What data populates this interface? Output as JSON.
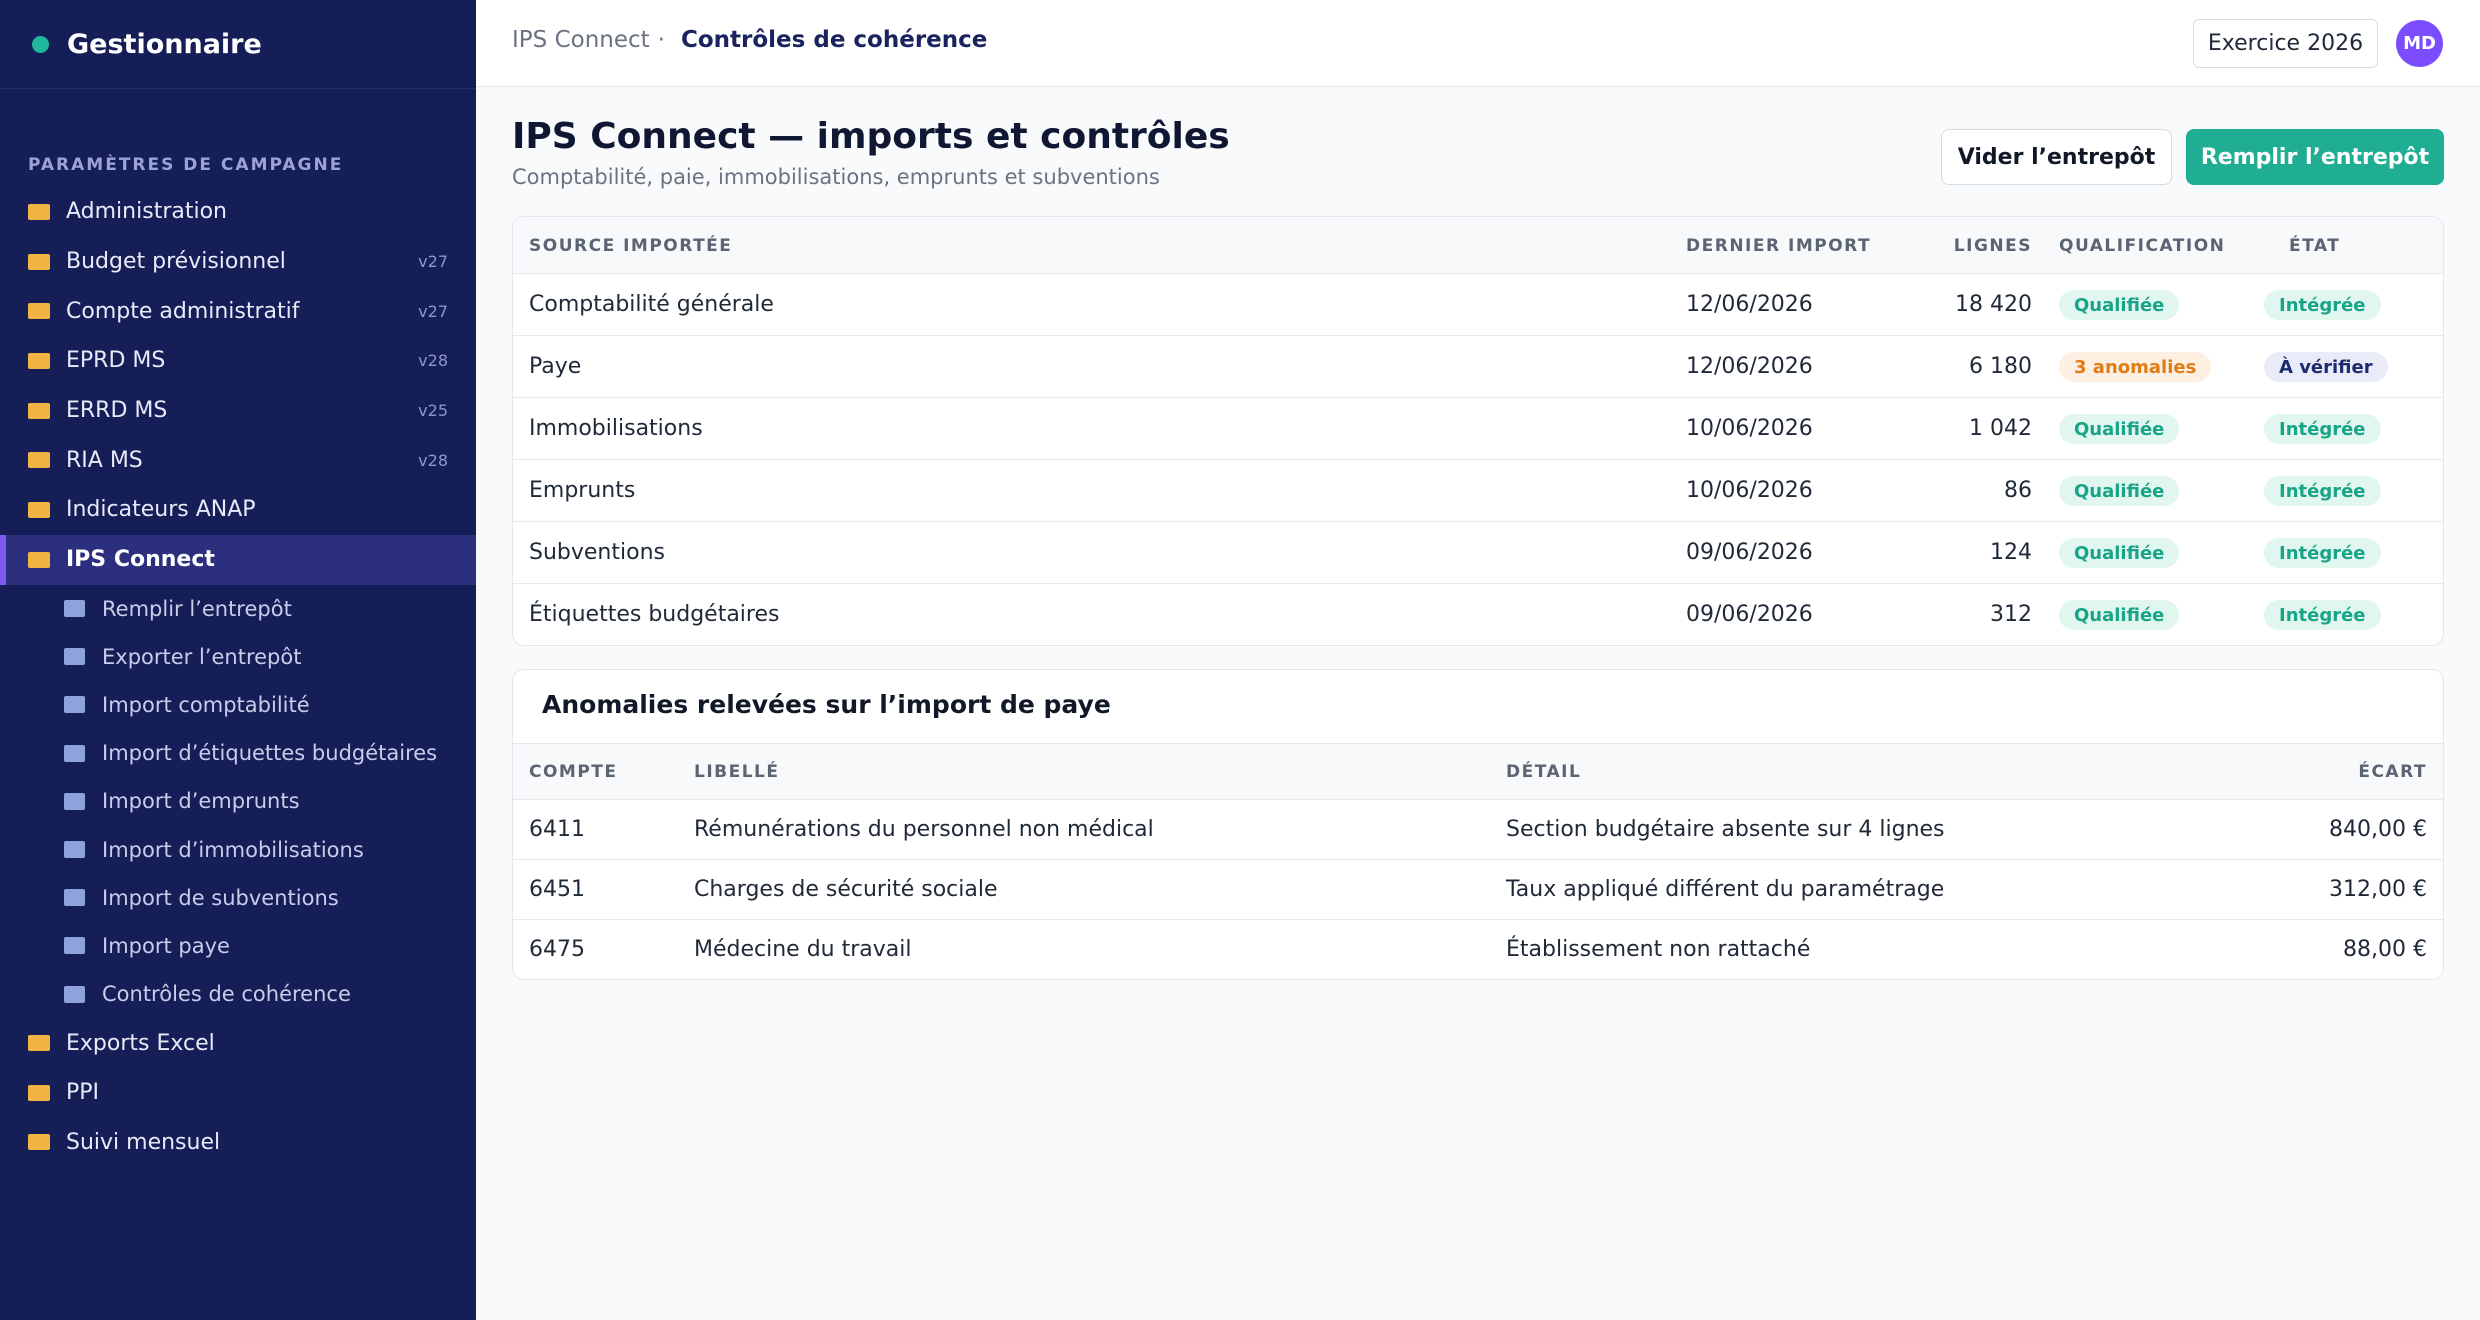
{
  "sidebar": {
    "brand": "Gestionnaire",
    "section_title": "PARAMÈTRES DE CAMPAGNE",
    "items": [
      {
        "label": "Administration",
        "version": ""
      },
      {
        "label": "Budget prévisionnel",
        "version": "v27"
      },
      {
        "label": "Compte administratif",
        "version": "v27"
      },
      {
        "label": "EPRD MS",
        "version": "v28"
      },
      {
        "label": "ERRD MS",
        "version": "v25"
      },
      {
        "label": "RIA MS",
        "version": "v28"
      },
      {
        "label": "Indicateurs ANAP",
        "version": ""
      },
      {
        "label": "IPS Connect",
        "version": ""
      }
    ],
    "subitems": [
      {
        "label": "Remplir l’entrepôt"
      },
      {
        "label": "Exporter l’entrepôt"
      },
      {
        "label": "Import comptabilité"
      },
      {
        "label": "Import d’étiquettes budgétaires"
      },
      {
        "label": "Import d’emprunts"
      },
      {
        "label": "Import d’immobilisations"
      },
      {
        "label": "Import de subventions"
      },
      {
        "label": "Import paye"
      },
      {
        "label": "Contrôles de cohérence"
      }
    ],
    "items_after": [
      {
        "label": "Exports Excel"
      },
      {
        "label": "PPI"
      },
      {
        "label": "Suivi mensuel"
      }
    ]
  },
  "topbar": {
    "breadcrumb_parent": "IPS Connect",
    "breadcrumb_sep": "·",
    "breadcrumb_current": "Contrôles de cohérence",
    "year_button": "Exercice 2026",
    "avatar_initials": "MD"
  },
  "header": {
    "title": "IPS Connect — imports et contrôles",
    "subtitle": "Comptabilité, paie, immobilisations, emprunts et subventions",
    "btn_empty": "Vider l’entrepôt",
    "btn_fill": "Remplir l’entrepôt"
  },
  "imports": {
    "columns": {
      "source": "SOURCE IMPORTÉE",
      "last_import": "DERNIER IMPORT",
      "lines": "LIGNES",
      "qualification": "QUALIFICATION",
      "state": "ÉTAT"
    },
    "rows": [
      {
        "source": "Comptabilité générale",
        "date": "12/06/2026",
        "lines": "18 420",
        "qualification": "Qualifiée",
        "state": "Intégrée"
      },
      {
        "source": "Paye",
        "date": "12/06/2026",
        "lines": "6 180",
        "qualification": "3 anomalies",
        "state": "À vérifier"
      },
      {
        "source": "Immobilisations",
        "date": "10/06/2026",
        "lines": "1 042",
        "qualification": "Qualifiée",
        "state": "Intégrée"
      },
      {
        "source": "Emprunts",
        "date": "10/06/2026",
        "lines": "86",
        "qualification": "Qualifiée",
        "state": "Intégrée"
      },
      {
        "source": "Subventions",
        "date": "09/06/2026",
        "lines": "124",
        "qualification": "Qualifiée",
        "state": "Intégrée"
      },
      {
        "source": "Étiquettes budgétaires",
        "date": "09/06/2026",
        "lines": "312",
        "qualification": "Qualifiée",
        "state": "Intégrée"
      }
    ]
  },
  "anomalies": {
    "title": "Anomalies relevées sur l’import de paye",
    "columns": {
      "account": "COMPTE",
      "label": "LIBELLÉ",
      "detail": "DÉTAIL",
      "gap": "ÉCART"
    },
    "rows": [
      {
        "account": "6411",
        "label": "Rémunérations du personnel non médical",
        "detail": "Section budgétaire absente sur 4 lignes",
        "gap": "840,00 €"
      },
      {
        "account": "6451",
        "label": "Charges de sécurité sociale",
        "detail": "Taux appliqué différent du paramétrage",
        "gap": "312,00 €"
      },
      {
        "account": "6475",
        "label": "Médecine du travail",
        "detail": "Établissement non rattaché",
        "gap": "88,00 €"
      }
    ]
  },
  "colors": {
    "sidebar_bg": "#161e58",
    "accent": "#1fae93",
    "active_marker": "#7c5cf0",
    "folder": "#f2b544",
    "warning": "#e07b16"
  }
}
